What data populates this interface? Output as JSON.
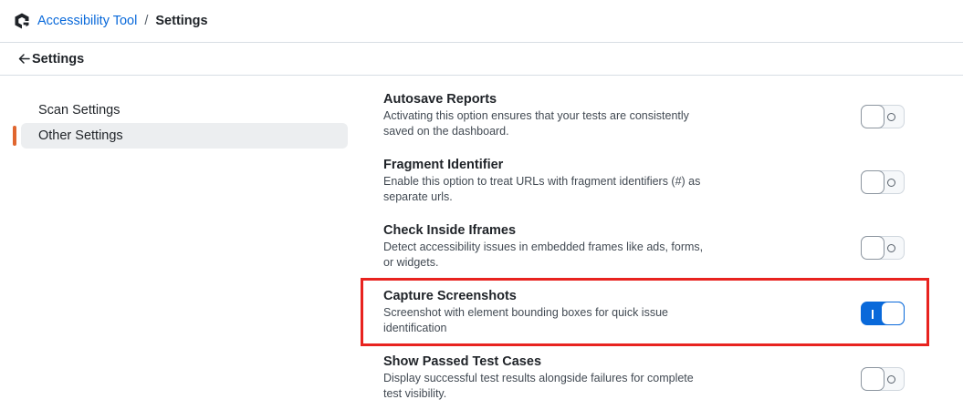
{
  "breadcrumb": {
    "app": "Accessibility Tool",
    "separator": "/",
    "current": "Settings"
  },
  "subheader": {
    "back_label": "Settings"
  },
  "sidebar": {
    "items": [
      {
        "label": "Scan Settings",
        "active": false
      },
      {
        "label": "Other Settings",
        "active": true
      }
    ]
  },
  "settings": [
    {
      "title": "Autosave Reports",
      "description": "Activating this option ensures that your tests are consistently saved on the dashboard.",
      "enabled": false
    },
    {
      "title": "Fragment Identifier",
      "description": "Enable this option to treat URLs with fragment identifiers (#) as separate urls.",
      "enabled": false
    },
    {
      "title": "Check Inside Iframes",
      "description": "Detect accessibility issues in embedded frames like ads, forms, or widgets.",
      "enabled": false
    },
    {
      "title": "Capture Screenshots",
      "description": "Screenshot with element bounding boxes for quick issue identification",
      "enabled": true
    },
    {
      "title": "Show Passed Test Cases",
      "description": "Display successful test results alongside failures for complete test visibility.",
      "enabled": false
    }
  ],
  "colors": {
    "link": "#0969da",
    "accent": "#e0662f",
    "toggle_on": "#0969da",
    "highlight": "#e8231f"
  }
}
